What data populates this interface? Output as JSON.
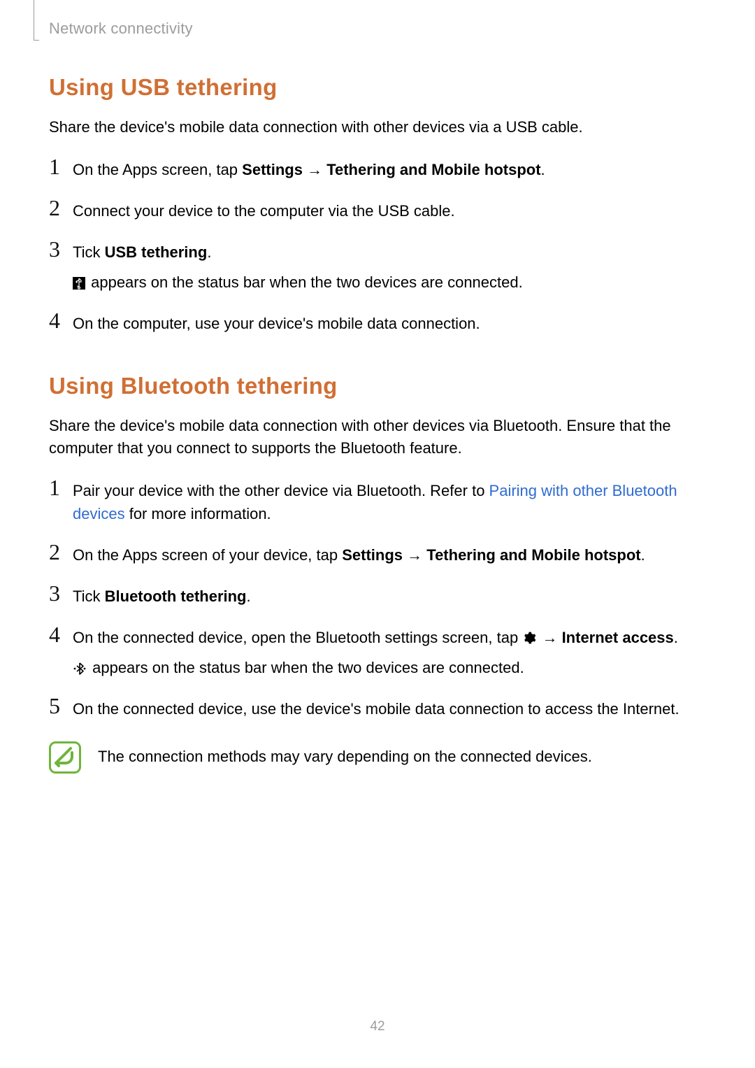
{
  "breadcrumb": "Network connectivity",
  "page_number": "42",
  "usb": {
    "heading": "Using USB tethering",
    "intro": "Share the device's mobile data connection with other devices via a USB cable.",
    "steps": {
      "s1": {
        "pre": "On the Apps screen, tap ",
        "bold1": "Settings",
        "arrow": " → ",
        "bold2": "Tethering and Mobile hotspot",
        "post": "."
      },
      "s2": "Connect your device to the computer via the USB cable.",
      "s3": {
        "pre": "Tick ",
        "bold": "USB tethering",
        "post": ".",
        "sub": " appears on the status bar when the two devices are connected."
      },
      "s4": "On the computer, use your device's mobile data connection."
    }
  },
  "bt": {
    "heading": "Using Bluetooth tethering",
    "intro": "Share the device's mobile data connection with other devices via Bluetooth. Ensure that the computer that you connect to supports the Bluetooth feature.",
    "steps": {
      "s1": {
        "pre": "Pair your device with the other device via Bluetooth. Refer to ",
        "link": "Pairing with other Bluetooth devices",
        "post": " for more information."
      },
      "s2": {
        "pre": "On the Apps screen of your device, tap ",
        "bold1": "Settings",
        "arrow": " → ",
        "bold2": "Tethering and Mobile hotspot",
        "post": "."
      },
      "s3": {
        "pre": "Tick ",
        "bold": "Bluetooth tethering",
        "post": "."
      },
      "s4": {
        "pre": "On the connected device, open the Bluetooth settings screen, tap ",
        "arrow": " → ",
        "bold": "Internet access",
        "post": ".",
        "sub": " appears on the status bar when the two devices are connected."
      },
      "s5": "On the connected device, use the device's mobile data connection to access the Internet."
    },
    "note": "The connection methods may vary depending on the connected devices."
  },
  "nums": {
    "n1": "1",
    "n2": "2",
    "n3": "3",
    "n4": "4",
    "n5": "5"
  }
}
